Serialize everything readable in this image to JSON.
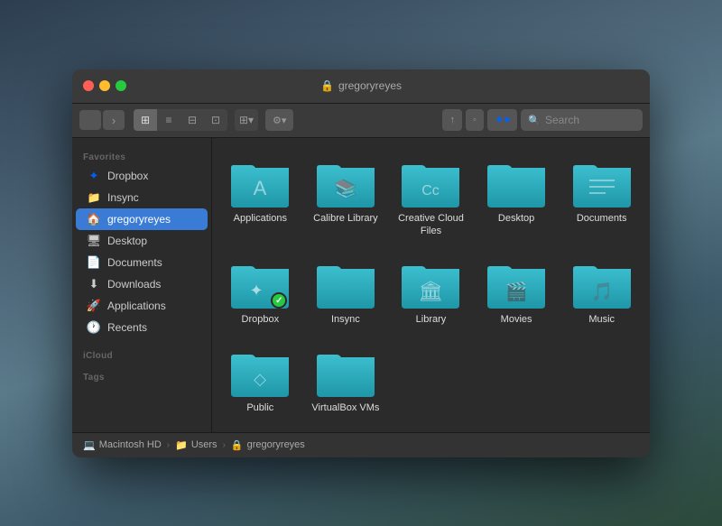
{
  "window": {
    "title": "gregoryreyes",
    "title_icon": "🔒"
  },
  "toolbar": {
    "back_label": "‹",
    "forward_label": "›",
    "view_icon": "⊞",
    "view_list": "≡",
    "view_columns": "⊟",
    "view_cover": "⊠",
    "view_grid": "⊞",
    "action_icon": "⚙",
    "share_icon": "↑",
    "tag_icon": "◦",
    "dropbox_icon": "✦",
    "search_placeholder": "Search"
  },
  "sidebar": {
    "favorites_label": "Favorites",
    "icloud_label": "iCloud",
    "tags_label": "Tags",
    "items": [
      {
        "id": "dropbox",
        "label": "Dropbox",
        "icon": "📦",
        "active": false
      },
      {
        "id": "insync",
        "label": "Insync",
        "icon": "🔄",
        "active": false
      },
      {
        "id": "gregoryreyes",
        "label": "gregoryreyes",
        "icon": "🏠",
        "active": true
      },
      {
        "id": "desktop",
        "label": "Desktop",
        "icon": "🖥",
        "active": false
      },
      {
        "id": "documents",
        "label": "Documents",
        "icon": "📄",
        "active": false
      },
      {
        "id": "downloads",
        "label": "Downloads",
        "icon": "⬇",
        "active": false
      },
      {
        "id": "applications",
        "label": "Applications",
        "icon": "🚀",
        "active": false
      },
      {
        "id": "recents",
        "label": "Recents",
        "icon": "🕐",
        "active": false
      }
    ]
  },
  "files": [
    {
      "id": "applications",
      "name": "Applications",
      "type": "folder",
      "icon_type": "apps"
    },
    {
      "id": "calibre",
      "name": "Calibre Library",
      "type": "folder",
      "icon_type": "books"
    },
    {
      "id": "creative-cloud",
      "name": "Creative Cloud Files",
      "type": "folder",
      "icon_type": "cc"
    },
    {
      "id": "desktop",
      "name": "Desktop",
      "type": "folder",
      "icon_type": "desktop"
    },
    {
      "id": "documents",
      "name": "Documents",
      "type": "folder",
      "icon_type": "docs"
    },
    {
      "id": "dropbox",
      "name": "Dropbox",
      "type": "folder",
      "icon_type": "dropbox",
      "badge": "✓"
    },
    {
      "id": "insync",
      "name": "Insync",
      "type": "folder",
      "icon_type": "insync"
    },
    {
      "id": "library",
      "name": "Library",
      "type": "folder",
      "icon_type": "library"
    },
    {
      "id": "movies",
      "name": "Movies",
      "type": "folder",
      "icon_type": "movies"
    },
    {
      "id": "music",
      "name": "Music",
      "type": "folder",
      "icon_type": "music"
    },
    {
      "id": "public",
      "name": "Public",
      "type": "folder",
      "icon_type": "public"
    },
    {
      "id": "virtualbox",
      "name": "VirtualBox VMs",
      "type": "folder",
      "icon_type": "virtualbox"
    }
  ],
  "breadcrumb": [
    {
      "label": "Macintosh HD",
      "icon": "💻"
    },
    {
      "label": "Users",
      "icon": "📁"
    },
    {
      "label": "gregoryreyes",
      "icon": "🔒"
    }
  ]
}
